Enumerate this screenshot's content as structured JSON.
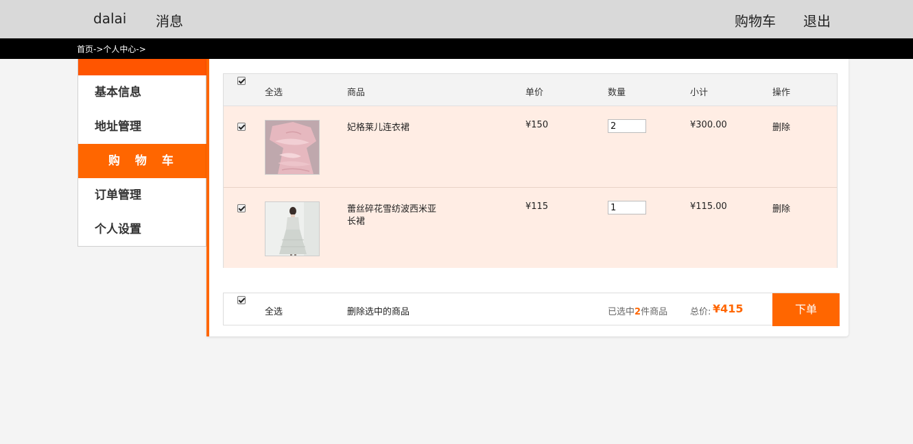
{
  "header": {
    "username": "dalai",
    "messages": "消息",
    "cart": "购物车",
    "logout": "退出"
  },
  "breadcrumb": "首页->个人中心->",
  "sidebar": {
    "items": [
      {
        "label": "基本信息"
      },
      {
        "label": "地址管理"
      },
      {
        "label": "购 物 车"
      },
      {
        "label": "订单管理"
      },
      {
        "label": "个人设置"
      }
    ],
    "active_index": 2
  },
  "cart_table": {
    "columns": [
      "全选",
      "商品",
      "单价",
      "数量",
      "小计",
      "操作"
    ],
    "select_all_checked": true,
    "rows": [
      {
        "checked": true,
        "name": "妃格莱儿连衣裙",
        "price": "¥150",
        "quantity": "2",
        "subtotal": "¥300.00",
        "action": "删除"
      },
      {
        "checked": true,
        "name_line1": "蕾丝碎花雪纺波西米亚",
        "name_line2": "长裙",
        "price": "¥115",
        "quantity": "1",
        "subtotal": "¥115.00",
        "action": "删除"
      }
    ]
  },
  "footer": {
    "select_all": "全选",
    "delete_selected": "删除选中的商品",
    "selected_prefix": "已选中",
    "selected_count": "2",
    "selected_suffix": "件商品",
    "total_label": "总价:",
    "total_value": "¥415",
    "order_button": "下单"
  },
  "colors": {
    "accent": "#ff6600",
    "accent_dark": "#ff5500",
    "row_bg": "#ffede4",
    "topbar_bg": "#d9d9d9"
  }
}
